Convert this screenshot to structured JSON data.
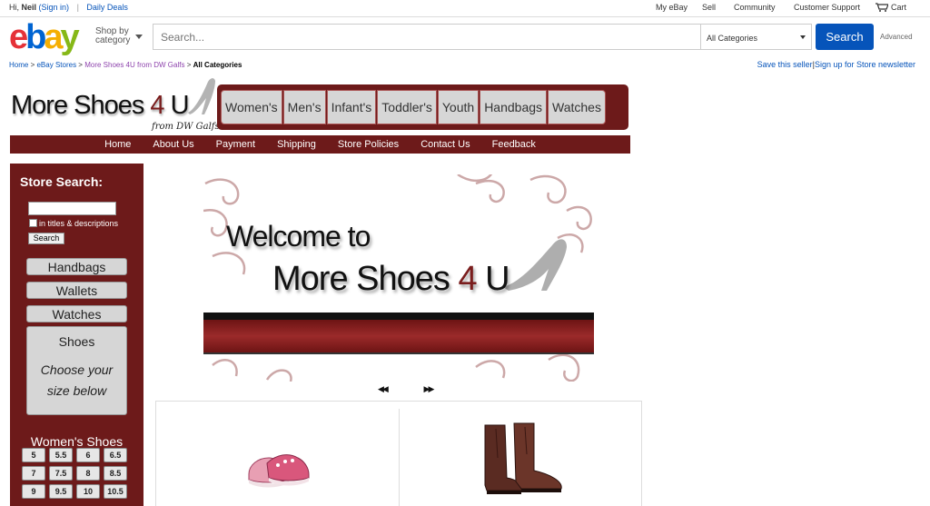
{
  "topbar": {
    "greeting_prefix": "Hi, ",
    "user": "Neil",
    "signin": "(Sign in)",
    "separator": "|",
    "daily_deals": "Daily Deals",
    "links": [
      "My eBay",
      "Sell",
      "Community",
      "Customer Support"
    ],
    "cart": "Cart"
  },
  "header": {
    "logo": [
      "e",
      "b",
      "a",
      "y"
    ],
    "shop_by": "Shop by",
    "category": "category",
    "search_placeholder": "Search...",
    "category_select": "All Categories",
    "search_button": "Search",
    "advanced": "Advanced"
  },
  "breadcrumb": {
    "items": [
      "Home",
      "eBay Stores",
      "More Shoes 4U from DW Galfs"
    ],
    "sep": ">",
    "current": "All Categories"
  },
  "store_links": {
    "save_seller": "Save this seller",
    "pipe": "|",
    "newsletter": "Sign up for Store newsletter"
  },
  "store": {
    "logo_text": "More Shoes ",
    "logo_four": "4",
    "logo_u": " U",
    "subtitle": "from DW Galfs",
    "categories": [
      "Women's",
      "Men's",
      "Infant's",
      "Toddler's",
      "Youth",
      "Handbags",
      "Watches"
    ],
    "nav": [
      "Home",
      "About Us",
      "Payment",
      "Shipping",
      "Store Policies",
      "Contact Us",
      "Feedback"
    ]
  },
  "sidebar": {
    "title": "Store Search:",
    "check_label": "in titles & descriptions",
    "search_button": "Search",
    "buttons": [
      "Handbags",
      "Wallets",
      "Watches"
    ],
    "shoes_title": "Shoes",
    "shoes_line1": "Choose your",
    "shoes_line2": "size below",
    "womens_title": "Women's Shoes",
    "sizes": [
      "5",
      "5.5",
      "6",
      "6.5",
      "7",
      "7.5",
      "8",
      "8.5",
      "9",
      "9.5",
      "10",
      "10.5"
    ]
  },
  "banner": {
    "line1": "Welcome to",
    "line2_text": "More Shoes ",
    "line2_four": "4",
    "line2_u": " U"
  },
  "carousel": {
    "prev": "◀◀",
    "next": "▶▶"
  },
  "colors": {
    "ebay_red": "#e53238",
    "ebay_blue": "#0064d2",
    "ebay_yellow": "#f5af02",
    "ebay_green": "#86b817",
    "store_maroon": "#6d1a1a",
    "link_blue": "#0654ba"
  }
}
